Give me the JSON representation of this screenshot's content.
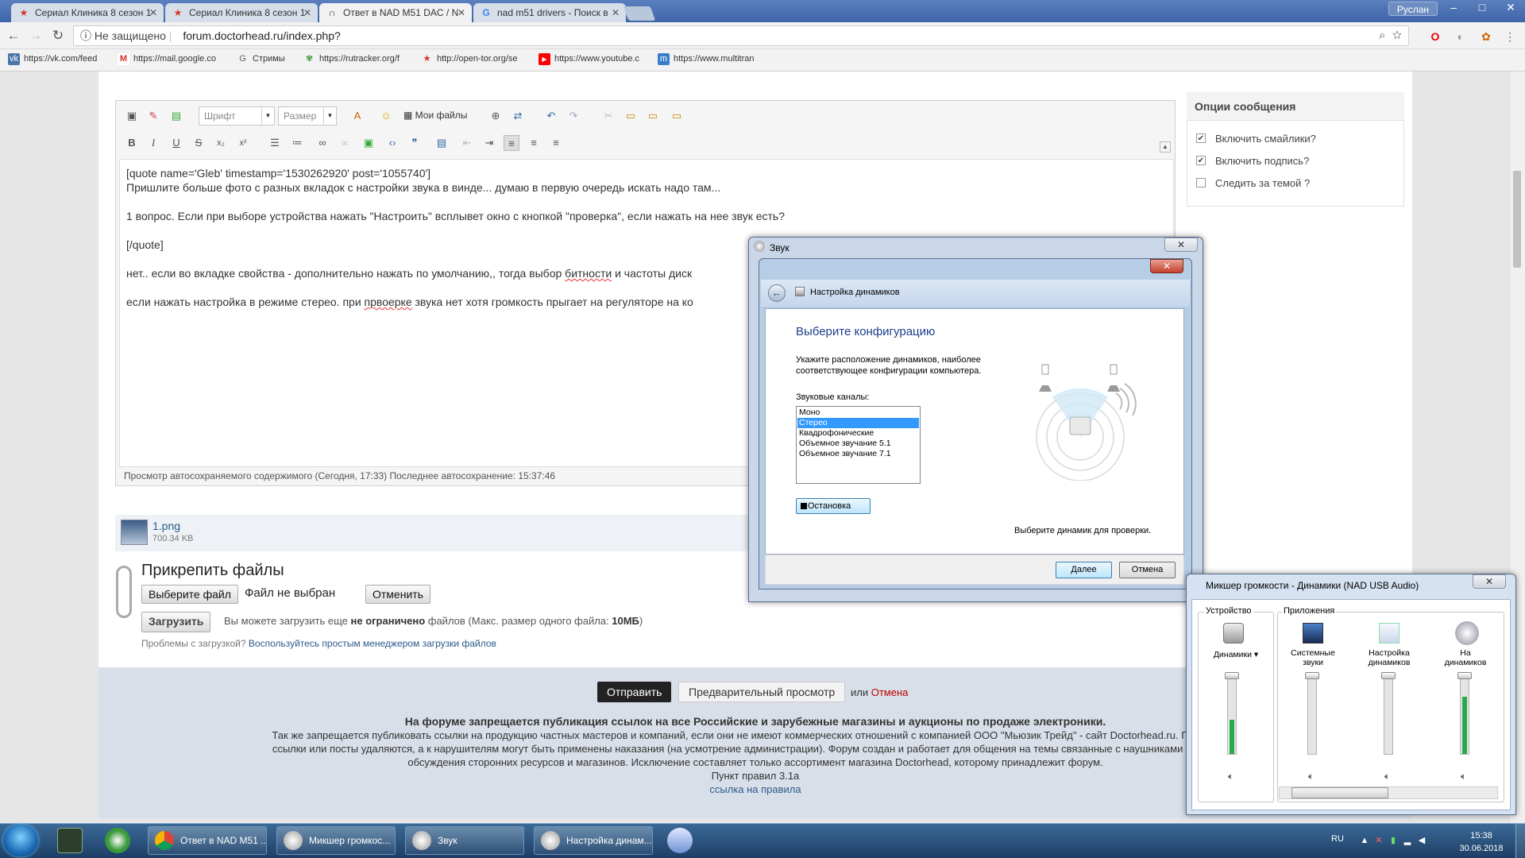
{
  "browser": {
    "tabs": [
      {
        "title": "Сериал Клиника 8 сезон 1",
        "icon": "star-icon",
        "color": "#d9342b"
      },
      {
        "title": "Сериал Клиника 8 сезон 1",
        "icon": "star-icon",
        "color": "#d9342b"
      },
      {
        "title": "Ответ в NAD M51 DAC / N",
        "icon": "headphones-icon",
        "color": "#333333"
      },
      {
        "title": "nad m51 drivers - Поиск в",
        "icon": "google-icon",
        "color": "#4285f4"
      }
    ],
    "user": "Руслан",
    "security_label": "Не защищено",
    "url": "forum.doctorhead.ru/index.php?",
    "bookmarks": [
      {
        "label": "https://vk.com/feed",
        "icon": "vk-icon",
        "color": "#4a76a8"
      },
      {
        "label": "https://mail.google.co",
        "icon": "gmail-icon",
        "color": "#d93025"
      },
      {
        "label": "Стримы",
        "icon": "g-icon",
        "color": "#666666"
      },
      {
        "label": "https://rutracker.org/f",
        "icon": "rutracker-icon",
        "color": "#3a9a3a"
      },
      {
        "label": "http://open-tor.org/se",
        "icon": "star-icon",
        "color": "#d9342b"
      },
      {
        "label": "https://www.youtube.c",
        "icon": "youtube-icon",
        "color": "#ff0000"
      },
      {
        "label": "https://www.multitran",
        "icon": "multitran-icon",
        "color": "#3a7dc9"
      }
    ]
  },
  "editor": {
    "font_placeholder": "Шрифт",
    "size_placeholder": "Размер",
    "myfiles": "Мои файлы",
    "lines": [
      "[quote name='Gleb' timestamp='1530262920' post='1055740']",
      "Пришлите больше фото с разных вкладок с настройки звука в винде... думаю в первую очередь искать надо там...",
      "1 вопрос. Если при выборе устройства нажать \"Настроить\" всплывет окно с кнопкой \"проверка\", если нажать на нее звук есть?",
      "[/quote]",
      "нет.. если во вкладке свойства - дополнительно нажать по умолчанию,, тогда выбор ",
      "битности",
      " и частоты диск",
      "если нажать настройка в режиме стерео. при ",
      "првоерке",
      " звука нет хотя громкость прыгает на регуляторе на ко"
    ],
    "autosave": "Просмотр автосохраняемого содержимого (Сегодня, 17:33)  Последнее автосохранение: 15:37:46"
  },
  "attachment": {
    "filename": "1.png",
    "size": "700.34 KB",
    "title": "Прикрепить файлы",
    "choose": "Выберите файл",
    "nofile": "Файл не выбран",
    "cancel": "Отменить",
    "upload": "Загрузить",
    "info_pre": "Вы можете загрузить еще ",
    "info_bold": "не ограничено",
    "info_mid": " файлов (Макс. размер одного файла: ",
    "info_size": "10МБ",
    "info_post": ")",
    "problems": "Проблемы с загрузкой? ",
    "problems_link": "Воспользуйтесь простым менеджером загрузки файлов"
  },
  "options": {
    "title": "Опции сообщения",
    "items": [
      {
        "label": "Включить смайлики?",
        "checked": "✔"
      },
      {
        "label": "Включить подпись?",
        "checked": "✔"
      },
      {
        "label": "Следить за темой ?",
        "checked": ""
      }
    ]
  },
  "form": {
    "send": "Отправить",
    "preview": "Предварительный просмотр",
    "or": "или ",
    "cancel": "Отмена",
    "rule_bold": "На форуме запрещается публикация ссылок на все Российские и зарубежные магазины и аукционы по продаже электроники.",
    "rule_l1": "Так же запрещается публиковать ссылки на продукцию частных мастеров и компаний, если они не имеют коммерческих отношений с компанией ООО \"Мьюзик Трейд\" - сайт Doctorhead.ru. Подобные с",
    "rule_l2": "ссылки или посты удаляются, а к нарушителям могут быть применены наказания (на усмотрение администрации). Форум создан и работает для общения на темы связанные с наушниками и аппарату",
    "rule_l3": "обсуждения сторонних ресурсов и магазинов. Исключение составляет только ассортимент магазина Doctorhead, которому принадлежит форум.",
    "rule_l4": "Пункт правил 3.1а",
    "rule_link": "ссылка на правила"
  },
  "sound_dialog": {
    "title": "Звук",
    "inner_title": "Настройка динамиков",
    "heading": "Выберите конфигурацию",
    "description": "Укажите расположение динамиков, наиболее соответствующее конфигурации компьютера.",
    "channels_label": "Звуковые каналы:",
    "channels": [
      "Моно",
      "Стерео",
      "Квадрофонические",
      "Объемное звучание 5.1",
      "Объемное звучание 7.1"
    ],
    "selected_index": 1,
    "stop": "Остановка",
    "pick_speaker": "Выберите динамик для проверки.",
    "next": "Далее",
    "cancel": "Отмена"
  },
  "mixer": {
    "title": "Микшер громкости - Динамики (NAD USB Audio)",
    "device_group": "Устройство",
    "apps_group": "Приложения",
    "channels": [
      {
        "label": "Динамики",
        "level": 0.45
      },
      {
        "label": "Системные звуки",
        "level": 0.0
      },
      {
        "label": "Настройка динамиков",
        "level": 0.0
      },
      {
        "label": "Нa динамиков",
        "level": 0.75
      }
    ]
  },
  "taskbar": {
    "items": [
      "Ответ в NAD M51 ...",
      "Микшер громкос...",
      "Звук",
      "Настройка динам..."
    ],
    "lang": "RU",
    "time": "15:38",
    "date": "30.06.2018"
  }
}
